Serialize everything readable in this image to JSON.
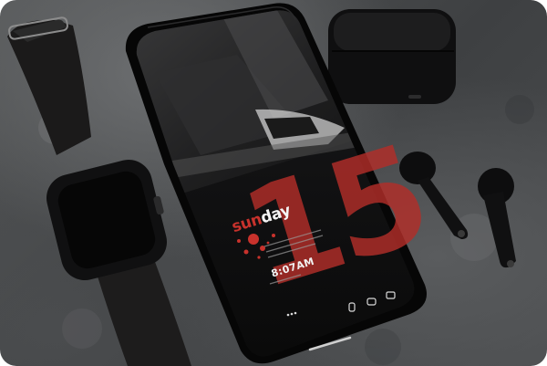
{
  "lockscreen": {
    "day_part_1": "sun",
    "day_part_2": "day",
    "date_number": "15",
    "time": "8:07AM"
  },
  "colors": {
    "accent_red": "#c8322c",
    "surface": "#4a4c4e",
    "device_black": "#0c0c0d"
  }
}
